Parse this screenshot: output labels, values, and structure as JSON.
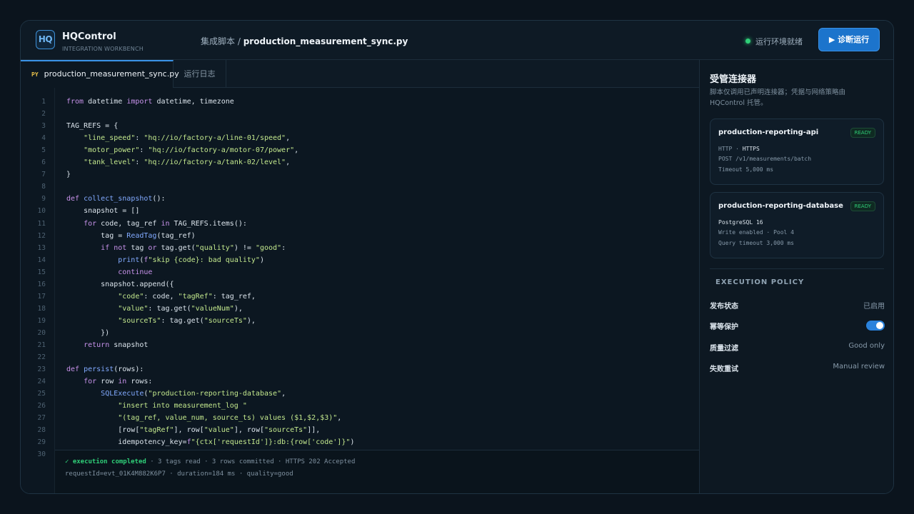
{
  "brand": {
    "logo": "HQ",
    "name": "HQControl",
    "subtitle": "INTEGRATION WORKBENCH"
  },
  "breadcrumb": {
    "parent": "集成脚本 /",
    "file": "production_measurement_sync.py"
  },
  "env_status": {
    "label": "运行环境就绪",
    "color": "#2fcf78"
  },
  "run_button": {
    "label": "▶ 诊断运行"
  },
  "tabs": [
    {
      "badge": "PY",
      "label": "production_measurement_sync.py",
      "active": true
    },
    {
      "label": "运行日志",
      "active": false
    }
  ],
  "editor": {
    "line_numbers": [
      "1",
      "2",
      "3",
      "4",
      "5",
      "6",
      "7",
      "8",
      "9",
      "10",
      "11",
      "12",
      "13",
      "14",
      "15",
      "16",
      "17",
      "18",
      "19",
      "20",
      "21",
      "22",
      "23",
      "24",
      "25",
      "26",
      "27",
      "28",
      "29",
      "30"
    ],
    "lines": [
      "from datetime import datetime, timezone",
      "",
      "TAG_REFS = {",
      "    \"line_speed\": \"hq://io/factory-a/line-01/speed\",",
      "    \"motor_power\": \"hq://io/factory-a/motor-07/power\",",
      "    \"tank_level\": \"hq://io/factory-a/tank-02/level\",",
      "}",
      "",
      "def collect_snapshot():",
      "    snapshot = []",
      "    for code, tag_ref in TAG_REFS.items():",
      "        tag = ReadTag(tag_ref)",
      "        if not tag or tag.get(\"quality\") != \"good\":",
      "            print(f\"skip {code}: bad quality\")",
      "            continue",
      "        snapshot.append({",
      "            \"code\": code, \"tagRef\": tag_ref,",
      "            \"value\": tag.get(\"valueNum\"),",
      "            \"sourceTs\": tag.get(\"sourceTs\"),",
      "        })",
      "    return snapshot",
      "",
      "def persist(rows):",
      "    for row in rows:",
      "        SQLExecute(\"production-reporting-database\",",
      "            \"insert into measurement_log \"",
      "            \"(tag_ref, value_num, source_ts) values ($1,$2,$3)\",",
      "            [row[\"tagRef\"], row[\"value\"], row[\"sourceTs\"]],",
      "            idempotency_key=f\"{ctx['requestId']}:db:{row['code']}\")",
      ""
    ]
  },
  "status_bar": {
    "result": "✓ execution completed",
    "summary": " · 3 tags read · 3 rows committed · HTTPS 202 Accepted",
    "details": "requestId=evt_01K4M882K6P7 · duration=184 ms · quality=good"
  },
  "side_panel": {
    "title": "受管连接器",
    "description": "脚本仅调用已声明连接器；凭据与网络策略由 HQControl 托管。",
    "connectors": [
      {
        "name": "production-reporting-api",
        "status": "READY",
        "line1_prefix": "HTTP · ",
        "line1_highlight": "HTTPS",
        "line2": "POST /v1/measurements/batch",
        "line3": "Timeout 5,000 ms"
      },
      {
        "name": "production-reporting-database",
        "status": "READY",
        "line1_highlight": "PostgreSQL 16",
        "line2": "Write enabled · Pool 4",
        "line3": "Query timeout 3,000 ms"
      }
    ],
    "policy_title": "EXECUTION POLICY",
    "policies": [
      {
        "label": "发布状态",
        "value": "已启用"
      },
      {
        "label": "幂等保护",
        "toggle": true
      },
      {
        "label": "质量过滤",
        "value": "Good only"
      },
      {
        "label": "失败重试",
        "value": "Manual review"
      }
    ]
  },
  "colors": {
    "accent": "#1c74cc",
    "ready": "#2fcf78",
    "keyword": "#c792ea",
    "string": "#c3e88d",
    "function": "#82aaff"
  }
}
